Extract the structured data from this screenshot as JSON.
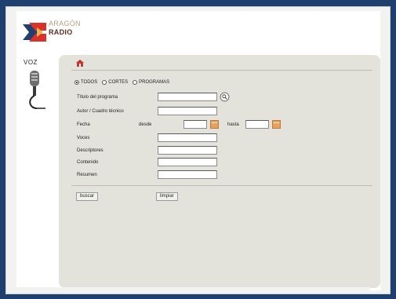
{
  "brand": {
    "line1": "ARAGÓN",
    "line2": "RADIO",
    "colors": {
      "red": "#d8322a",
      "navy": "#1f3f6e",
      "gold": "#b9a07c"
    }
  },
  "section": {
    "title": "VOZ",
    "icon": "microphone-icon"
  },
  "nav": {
    "home_icon": "home-icon"
  },
  "filter": {
    "options": [
      {
        "label": "TODOS",
        "selected": true
      },
      {
        "label": "CORTES",
        "selected": false
      },
      {
        "label": "PROGRAMAS",
        "selected": false
      }
    ]
  },
  "form": {
    "titulo_label": "Título del programa",
    "autor_label": "Autor / Cuadro técnico",
    "fecha_label": "Fecha",
    "desde_label": "desde",
    "hasta_label": "hasta",
    "voces_label": "Voces",
    "descriptores_label": "Descriptores",
    "contenido_label": "Contenido",
    "resumen_label": "Resumen",
    "titulo_value": "",
    "autor_value": "",
    "desde_value": "",
    "hasta_value": "",
    "voces_value": "",
    "descriptores_value": "",
    "contenido_value": "",
    "resumen_value": ""
  },
  "actions": {
    "buscar": "buscar",
    "limpiar": "limpiar"
  }
}
